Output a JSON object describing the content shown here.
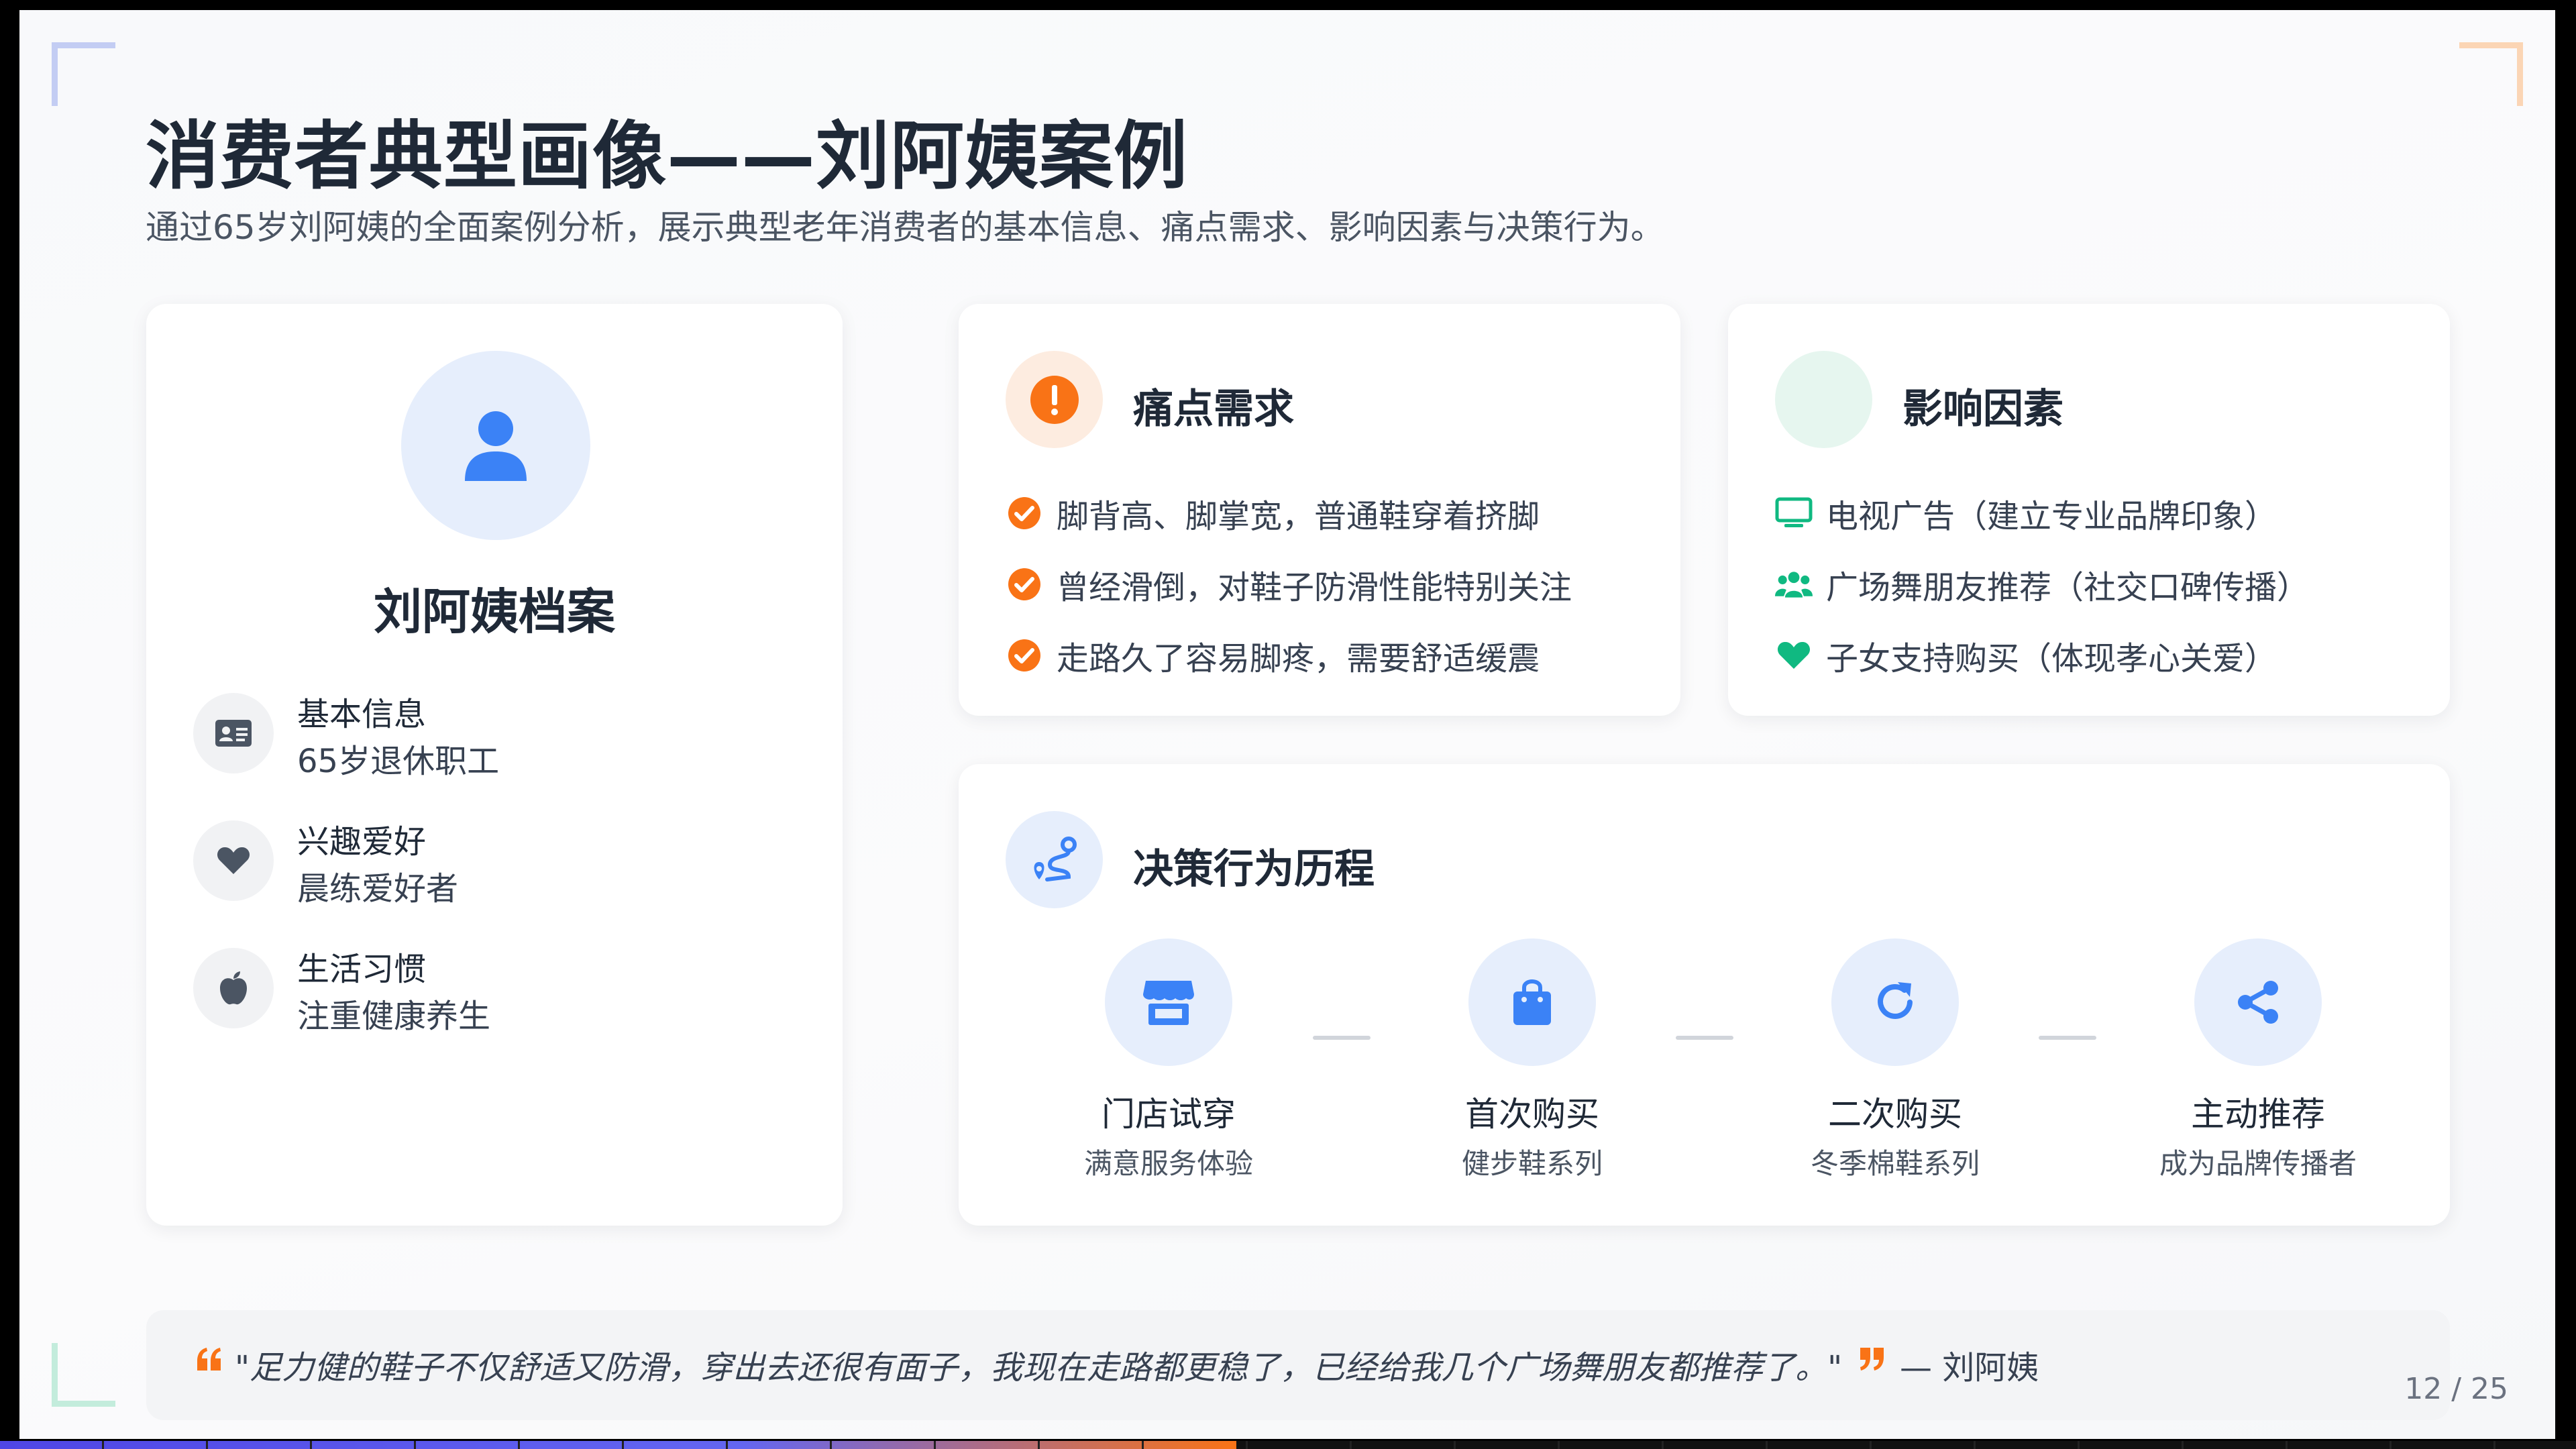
{
  "slide": {
    "title": "消费者典型画像——刘阿姨案例",
    "subtitle": "通过65岁刘阿姨的全面案例分析，展示典型老年消费者的基本信息、痛点需求、影响因素与决策行为。"
  },
  "profile": {
    "title": "刘阿姨档案",
    "items": [
      {
        "icon": "id-card-icon",
        "label": "基本信息",
        "value": "65岁退休职工"
      },
      {
        "icon": "heart-icon",
        "label": "兴趣爱好",
        "value": "晨练爱好者"
      },
      {
        "icon": "apple-icon",
        "label": "生活习惯",
        "value": "注重健康养生"
      }
    ]
  },
  "pain": {
    "title": "痛点需求",
    "icon": "exclamation-circle-icon",
    "items": [
      "脚背高、脚掌宽，普通鞋穿着挤脚",
      "曾经滑倒，对鞋子防滑性能特别关注",
      "走路久了容易脚疼，需要舒适缓震"
    ]
  },
  "factors": {
    "title": "影响因素",
    "items": [
      {
        "icon": "tv-icon",
        "text": "电视广告（建立专业品牌印象）"
      },
      {
        "icon": "users-icon",
        "text": "广场舞朋友推荐（社交口碑传播）"
      },
      {
        "icon": "heart-icon",
        "text": "子女支持购买（体现孝心关爱）"
      }
    ]
  },
  "decision": {
    "title": "决策行为历程",
    "icon": "route-icon",
    "steps": [
      {
        "icon": "store-icon",
        "title": "门店试穿",
        "desc": "满意服务体验"
      },
      {
        "icon": "shopping-bag-icon",
        "title": "首次购买",
        "desc": "健步鞋系列"
      },
      {
        "icon": "redo-icon",
        "title": "二次购买",
        "desc": "冬季棉鞋系列"
      },
      {
        "icon": "share-icon",
        "title": "主动推荐",
        "desc": "成为品牌传播者"
      }
    ]
  },
  "quote": {
    "text": "\"足力健的鞋子不仅舒适又防滑，穿出去还很有面子，我现在走路都更稳了，已经给我几个广场舞朋友都推荐了。\"",
    "author": "— 刘阿姨"
  },
  "pagination": {
    "label": "12 / 25",
    "current": 12,
    "total": 25
  },
  "colors": {
    "accent_blue": "#3b82f6",
    "accent_orange": "#f97316",
    "accent_green": "#10b981",
    "text_dark": "#1f2937"
  }
}
